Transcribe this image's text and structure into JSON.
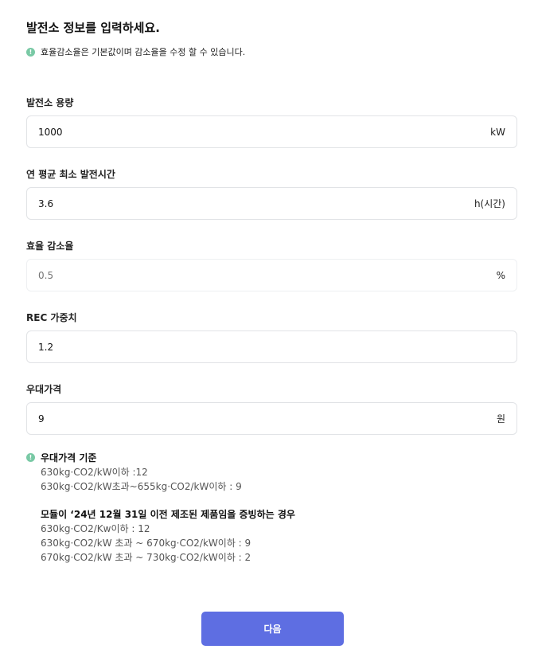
{
  "header": {
    "title": "발전소 정보를 입력하세요.",
    "info_icon": "info-icon",
    "info_text": "효율감소율은 기본값이며 감소율을 수정 할 수 있습니다."
  },
  "fields": [
    {
      "label": "발전소 용량",
      "value": "1000",
      "unit": "kW"
    },
    {
      "label": "연 평균 최소 발전시간",
      "value": "3.6",
      "unit": "h(시간)"
    },
    {
      "label": "효율 감소율",
      "value": "",
      "placeholder": "0.5",
      "unit": "%"
    },
    {
      "label": "REC 가중치",
      "value": "1.2",
      "unit": ""
    },
    {
      "label": "우대가격",
      "value": "9",
      "unit": "원"
    }
  ],
  "notes": {
    "title": "우대가격 기준",
    "lines": [
      "630kg·CO2/kW이하 :12",
      "630kg·CO2/kW초과~655kg·CO2/kW이하 : 9"
    ],
    "sub_title": "모듈이 ‘24년 12월 31일 이전 제조된 제품임을 증빙하는 경우",
    "sub_lines": [
      "630kg·CO2/Kw이하 : 12",
      "630kg·CO2/kW 초과 ~ 670kg·CO2/kW이하 : 9",
      "670kg·CO2/kW 초과 ~ 730kg·CO2/kW이하 : 2"
    ]
  },
  "actions": {
    "next_label": "다음"
  },
  "colors": {
    "primary": "#5e6ee2",
    "info": "#79c9a5",
    "border": "#e1e3e6"
  }
}
